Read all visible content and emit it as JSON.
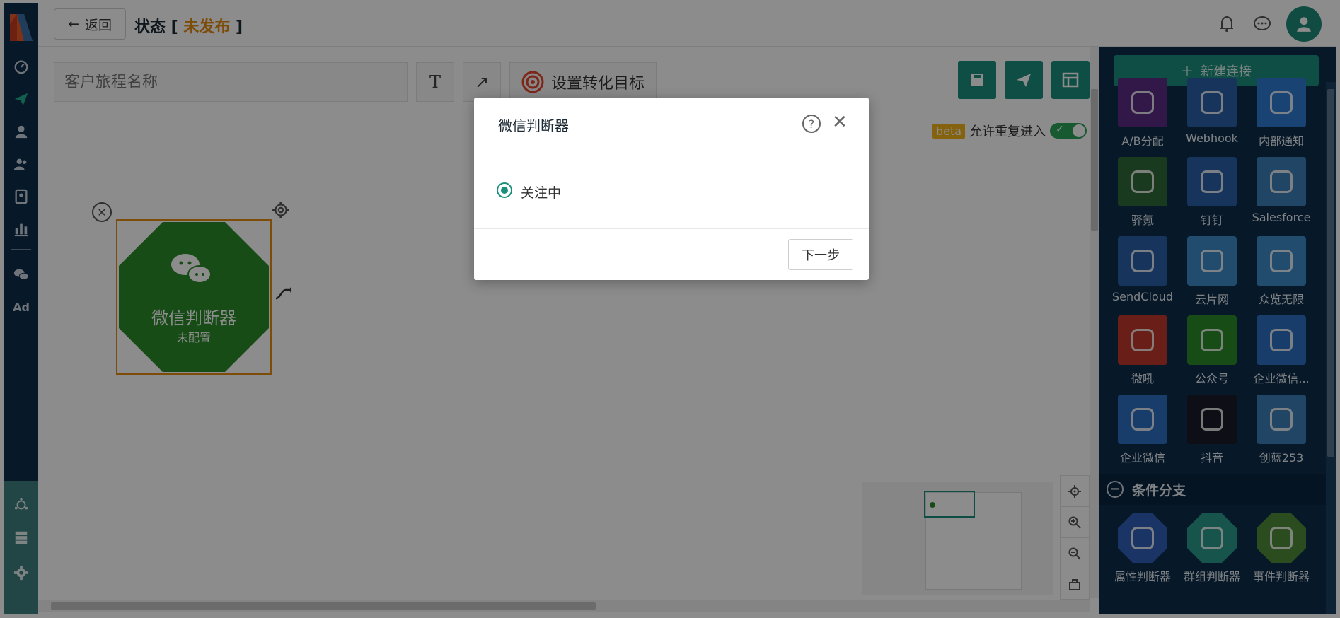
{
  "header": {
    "back_label": "返回",
    "status_prefix": "状态 [ ",
    "status_value": "未发布",
    "status_suffix": " ]"
  },
  "toolbar": {
    "journey_name_placeholder": "客户旅程名称",
    "text_tool": "T",
    "arrow_tool": "↗",
    "goal_label": "设置转化目标",
    "beta_badge": "beta",
    "reentry_label": "允许重复进入",
    "reentry_on": true
  },
  "node": {
    "title": "微信判断器",
    "subtitle": "未配置",
    "fill_color": "#2b8a2b",
    "border_color": "#e38a0f"
  },
  "palette": {
    "new_connection": "新建连接",
    "items": [
      {
        "label": "A/B分配",
        "color": "#5b2d86",
        "icon": "ab-split-icon"
      },
      {
        "label": "Webhook",
        "color": "#2a62a8",
        "icon": "webhook-icon"
      },
      {
        "label": "内部通知",
        "color": "#2f7bd0",
        "icon": "bell-icon"
      },
      {
        "label": "驿氪",
        "color": "#2f6b3a",
        "icon": "spider-icon"
      },
      {
        "label": "钉钉",
        "color": "#2a62a8",
        "icon": "dingtalk-icon"
      },
      {
        "label": "Salesforce",
        "color": "#3d7fb8",
        "icon": "cloud-icon"
      },
      {
        "label": "SendCloud",
        "color": "#2a62a8",
        "icon": "sendcloud-icon"
      },
      {
        "label": "云片网",
        "color": "#3d8ac9",
        "icon": "yunpian-icon"
      },
      {
        "label": "众览无限",
        "color": "#3d8ac9",
        "icon": "zhonglan-icon"
      },
      {
        "label": "微吼",
        "color": "#c0392b",
        "icon": "weihou-icon"
      },
      {
        "label": "公众号",
        "color": "#2b8a2b",
        "icon": "wechat-icon"
      },
      {
        "label": "企业微信...",
        "color": "#2f6fc4",
        "icon": "work-wechat-icon"
      },
      {
        "label": "企业微信",
        "color": "#2f6fc4",
        "icon": "work-wechat-icon"
      },
      {
        "label": "抖音",
        "color": "#1a1a2a",
        "icon": "tiktok-icon"
      },
      {
        "label": "创蓝253",
        "color": "#3d7fb8",
        "icon": "chuanglan-icon"
      }
    ],
    "condition_section": "条件分支",
    "conditions": [
      {
        "label": "属性判断器",
        "color": "#2f5fb8",
        "icon": "edit-icon"
      },
      {
        "label": "群组判断器",
        "color": "#2a9b8a",
        "icon": "group-icon"
      },
      {
        "label": "事件判断器",
        "color": "#4f8a3a",
        "icon": "list-icon"
      }
    ]
  },
  "modal": {
    "title": "微信判断器",
    "option_label": "关注中",
    "next_label": "下一步"
  }
}
